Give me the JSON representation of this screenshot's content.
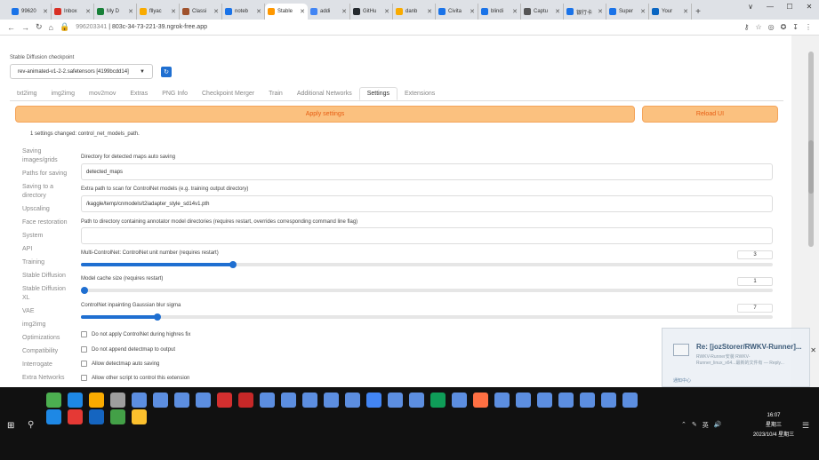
{
  "browser": {
    "tabs": [
      {
        "label": "99620",
        "color": "#1a73e8",
        "active": false
      },
      {
        "label": "Inbox",
        "color": "#d93025",
        "active": false
      },
      {
        "label": "My D",
        "color": "#188038",
        "active": false
      },
      {
        "label": "fllyac",
        "color": "#f9ab00",
        "active": false
      },
      {
        "label": "Classi",
        "color": "#a0522d",
        "active": false
      },
      {
        "label": "noteb",
        "color": "#1a73e8",
        "active": false
      },
      {
        "label": "Stable",
        "color": "#ff9800",
        "active": true
      },
      {
        "label": "addi",
        "color": "#4285f4",
        "active": false
      },
      {
        "label": "GitHu",
        "color": "#24292e",
        "active": false
      },
      {
        "label": "danb",
        "color": "#f9ab00",
        "active": false
      },
      {
        "label": "Civita",
        "color": "#1a73e8",
        "active": false
      },
      {
        "label": "blindi",
        "color": "#1a73e8",
        "active": false
      },
      {
        "label": "Captu",
        "color": "#555555",
        "active": false
      },
      {
        "label": "银行卡",
        "color": "#1a73e8",
        "active": false
      },
      {
        "label": "Super",
        "color": "#1a73e8",
        "active": false
      },
      {
        "label": "Your",
        "color": "#0a66c2",
        "active": false
      }
    ],
    "new_tab": "+",
    "window_controls": [
      "∨",
      "—",
      "☐",
      "✕"
    ],
    "url_id": "996203341",
    "url": "803c-34-73-221-39.ngrok-free.app"
  },
  "checkpoint": {
    "label": "Stable Diffusion checkpoint",
    "value": "rev-animated-v1-2-2.safetensors [4199bcdd14]"
  },
  "nav_tabs": [
    "txt2img",
    "img2img",
    "mov2mov",
    "Extras",
    "PNG Info",
    "Checkpoint Merger",
    "Train",
    "Additional Networks",
    "Settings",
    "Extensions"
  ],
  "active_tab": "Settings",
  "buttons": {
    "apply": "Apply settings",
    "reload": "Reload UI"
  },
  "changed_msg": "1 settings changed: control_net_models_path.",
  "sidebar": [
    "Saving images/grids",
    "Paths for saving",
    "Saving to a directory",
    "Upscaling",
    "Face restoration",
    "System",
    "API",
    "Training",
    "Stable Diffusion",
    "Stable Diffusion XL",
    "VAE",
    "img2img",
    "Optimizations",
    "Compatibility",
    "Interrogate",
    "Extra Networks"
  ],
  "fields": {
    "detected_maps_label": "Directory for detected maps auto saving",
    "detected_maps_value": "detected_maps",
    "extra_path_label": "Extra path to scan for ControlNet models (e.g. training output directory)",
    "extra_path_value": "/kaggle/temp/cnmodels/t2iadapter_style_sd14v1.pth",
    "annotator_label": "Path to directory containing annotator model directories (requires restart, overrides corresponding command line flag)",
    "annotator_value": "",
    "unit_label": "Multi-ControlNet: ControlNet unit number (requires restart)",
    "unit_value": "3",
    "unit_fraction": 0.22,
    "cache_label": "Model cache size (requires restart)",
    "cache_value": "1",
    "cache_fraction": 0.0,
    "blur_label": "ControlNet inpainting Gaussian blur sigma",
    "blur_value": "7",
    "blur_fraction": 0.11
  },
  "checks": [
    "Do not apply ControlNet during highres fix",
    "Do not append detectmap to output",
    "Allow detectmap auto saving",
    "Allow other script to control this extension"
  ],
  "toast": {
    "title": "Re: [jozStorer/RWKV-Runner]...",
    "line1": "RWKV-Runner安装 RWKV-",
    "line2": "Runner_linux_x64...最新的文件有 — Reply...",
    "bottom": "通知中心"
  },
  "taskbar": {
    "time": "16:07",
    "weekday": "星期三",
    "date": "2023/10/4 星期三",
    "lang": "英"
  }
}
